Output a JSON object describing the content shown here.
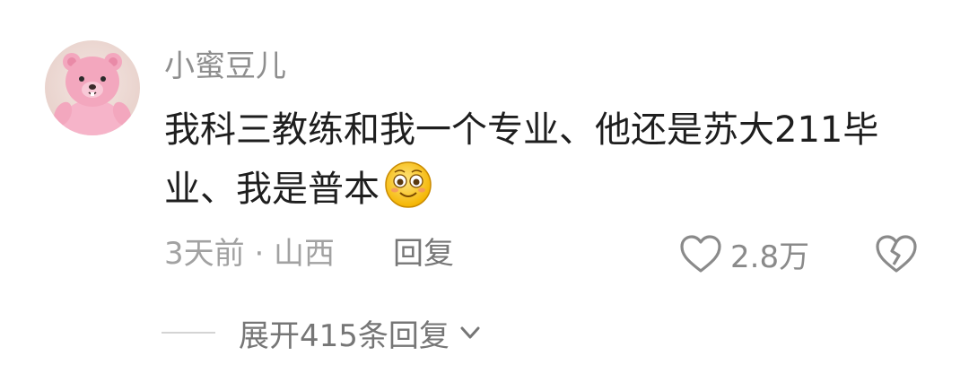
{
  "comment": {
    "username": "小蜜豆儿",
    "text": "我科三教练和我一个专业、他还是苏大211毕业、我是普本",
    "emoji": "smiling-face-emoji",
    "meta": "3天前 · 山西",
    "reply_label": "回复",
    "like_count": "2.8万",
    "expand_label": "展开415条回复"
  },
  "colors": {
    "username": "#8e8e8e",
    "text": "#1e1e1e",
    "meta": "#a2a2a2",
    "avatar_pink": "#f0a6bd"
  }
}
